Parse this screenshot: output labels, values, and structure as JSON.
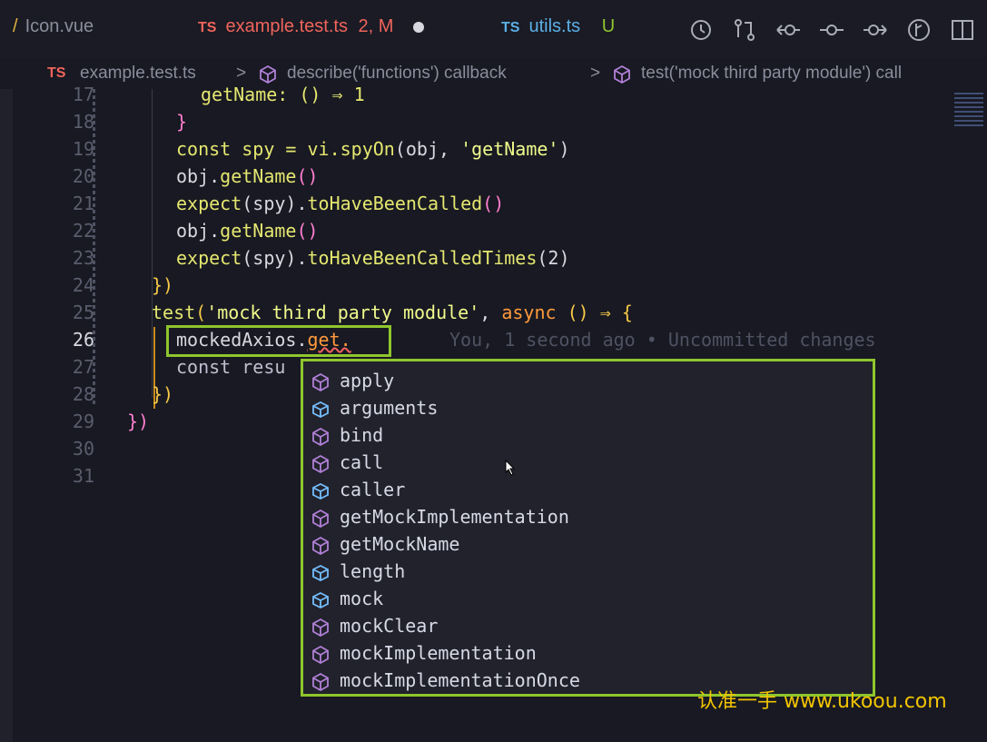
{
  "tabs": [
    {
      "label": "Icon.vue",
      "prefix": "/",
      "badge": ""
    },
    {
      "label": "example.test.ts",
      "prefix": "TS",
      "badge": "2, M"
    },
    {
      "label": "utils.ts",
      "prefix": "TS",
      "badge": "U"
    }
  ],
  "breadcrumb": {
    "file": "example.test.ts",
    "sep": ">",
    "item1": "describe('functions') callback",
    "item2": "test('mock third party module') call"
  },
  "editor": {
    "lines": [
      {
        "num": "17"
      },
      {
        "num": "18"
      },
      {
        "num": "19"
      },
      {
        "num": "20"
      },
      {
        "num": "21"
      },
      {
        "num": "22"
      },
      {
        "num": "23"
      },
      {
        "num": "24"
      },
      {
        "num": "25"
      },
      {
        "num": "26"
      },
      {
        "num": "27"
      },
      {
        "num": "28"
      },
      {
        "num": "29"
      },
      {
        "num": "30"
      },
      {
        "num": "31"
      }
    ],
    "code": {
      "l17": "getName: () ⇒ 1",
      "l18": "}",
      "l19a": "const spy = vi.",
      "l19b": "spyOn",
      "l19c": "(obj, ",
      "l19d": "'getName'",
      "l19e": ")",
      "l20a": "obj.",
      "l20b": "getName",
      "l20c": "()",
      "l21a": "expect",
      "l21b": "(spy).",
      "l21c": "toHaveBeenCalled",
      "l21d": "()",
      "l22a": "obj.",
      "l22b": "getName",
      "l22c": "()",
      "l23a": "expect",
      "l23b": "(spy).",
      "l23c": "toHaveBeenCalledTimes",
      "l23d": "(2)",
      "l24": "})",
      "l25a": "test",
      "l25b": "(",
      "l25c": "'mock third party module'",
      "l25d": ", ",
      "l25e": "async",
      "l25f": " () ⇒ {",
      "l26a": "mockedAxios.",
      "l26b": "get.",
      "l27": "const resu",
      "l28": "})",
      "l29": "})"
    },
    "blame": "You, 1 second ago • Uncommitted changes"
  },
  "suggestions": [
    {
      "label": "apply",
      "icon": "method-icon"
    },
    {
      "label": "arguments",
      "icon": "field-icon"
    },
    {
      "label": "bind",
      "icon": "method-icon"
    },
    {
      "label": "call",
      "icon": "method-icon"
    },
    {
      "label": "caller",
      "icon": "field-icon"
    },
    {
      "label": "getMockImplementation",
      "icon": "method-icon"
    },
    {
      "label": "getMockName",
      "icon": "method-icon"
    },
    {
      "label": "length",
      "icon": "field-icon"
    },
    {
      "label": "mock",
      "icon": "field-icon"
    },
    {
      "label": "mockClear",
      "icon": "method-icon"
    },
    {
      "label": "mockImplementation",
      "icon": "method-icon"
    },
    {
      "label": "mockImplementationOnce",
      "icon": "method-icon"
    }
  ],
  "watermark": "认准一手 www.ukoou.com",
  "colors": {
    "accent": "#8fc62d",
    "method": "#b180d7",
    "field": "#75beff"
  }
}
